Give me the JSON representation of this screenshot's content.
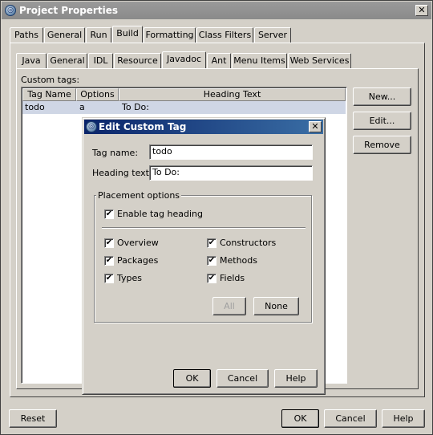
{
  "window": {
    "title": "Project Properties",
    "close_glyph": "✕",
    "icon_glyph": "◎"
  },
  "main_tabs": [
    {
      "label": "Paths"
    },
    {
      "label": "General"
    },
    {
      "label": "Run"
    },
    {
      "label": "Build"
    },
    {
      "label": "Formatting"
    },
    {
      "label": "Class Filters"
    },
    {
      "label": "Server"
    }
  ],
  "sub_tabs": [
    {
      "label": "Java"
    },
    {
      "label": "General"
    },
    {
      "label": "IDL"
    },
    {
      "label": "Resource"
    },
    {
      "label": "Javadoc"
    },
    {
      "label": "Ant"
    },
    {
      "label": "Menu Items"
    },
    {
      "label": "Web Services"
    }
  ],
  "custom_tags": {
    "label": "Custom tags:",
    "columns": [
      "Tag Name",
      "Options",
      "Heading Text"
    ],
    "rows": [
      {
        "tag": "todo",
        "options": "a",
        "heading": "To Do:"
      }
    ],
    "buttons": {
      "new": "New...",
      "edit": "Edit...",
      "remove": "Remove"
    }
  },
  "footer": {
    "reset": "Reset",
    "ok": "OK",
    "cancel": "Cancel",
    "help": "Help"
  },
  "dialog": {
    "title": "Edit Custom Tag",
    "icon_glyph": "◎",
    "close_glyph": "✕",
    "tag_name_label": "Tag name:",
    "tag_name_value": "todo",
    "heading_label": "Heading text:",
    "heading_value": "To Do:",
    "placement_label": "Placement options",
    "enable_heading": {
      "label": "Enable tag heading",
      "checked": true
    },
    "options": [
      {
        "label": "Overview",
        "checked": true
      },
      {
        "label": "Packages",
        "checked": true
      },
      {
        "label": "Types",
        "checked": true
      },
      {
        "label": "Constructors",
        "checked": true
      },
      {
        "label": "Methods",
        "checked": true
      },
      {
        "label": "Fields",
        "checked": true
      }
    ],
    "all_label": "All",
    "none_label": "None",
    "ok": "OK",
    "cancel": "Cancel",
    "help": "Help",
    "check_glyph": "✔"
  }
}
